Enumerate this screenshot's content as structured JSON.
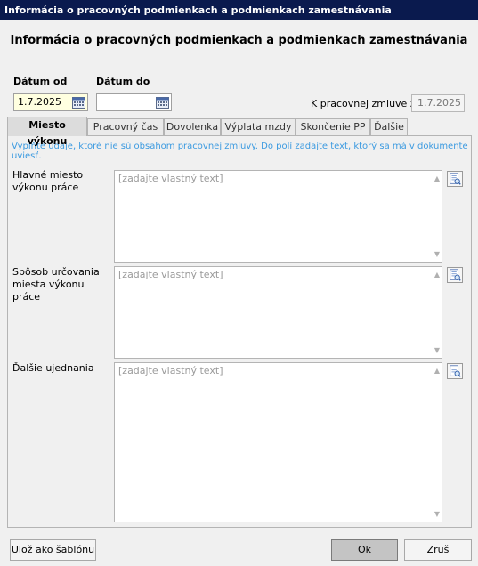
{
  "window": {
    "title": "Informácia o pracovných podmienkach a podmienkach zamestnávania"
  },
  "heading": "Informácia o pracovných podmienkach a podmienkach zamestnávania",
  "dates": {
    "from_label": "Dátum od",
    "from_value": "1.7.2025",
    "to_label": "Dátum do",
    "to_value": "",
    "contract_label": "K pracovnej zmluve z",
    "contract_value": "1.7.2025"
  },
  "tabs": [
    {
      "label": "Miesto výkonu"
    },
    {
      "label": "Pracovný čas"
    },
    {
      "label": "Dovolenka"
    },
    {
      "label": "Výplata mzdy"
    },
    {
      "label": "Skončenie PP"
    },
    {
      "label": "Ďalšie"
    }
  ],
  "active_tab": "Miesto výkonu",
  "panel": {
    "hint": "Vyplňte údaje, ktoré nie sú obsahom pracovnej zmluvy. Do polí zadajte text, ktorý sa má v dokumente uviesť.",
    "fields": [
      {
        "label": "Hlavné miesto výkonu práce",
        "placeholder": "[zadajte vlastný text]"
      },
      {
        "label": "Spôsob určovania miesta výkonu práce",
        "placeholder": "[zadajte vlastný text]"
      },
      {
        "label": "Ďalšie ujednania",
        "placeholder": "[zadajte vlastný text]"
      }
    ]
  },
  "buttons": {
    "save_template": "Ulož ako šablónu",
    "ok": "Ok",
    "cancel": "Zruš"
  },
  "colors": {
    "titlebar": "#0a1a4e",
    "hint": "#3b9ae0",
    "date_highlight": "#ffffe0"
  },
  "icons": {
    "calendar": "calendar-icon",
    "template": "template-picker-icon"
  }
}
